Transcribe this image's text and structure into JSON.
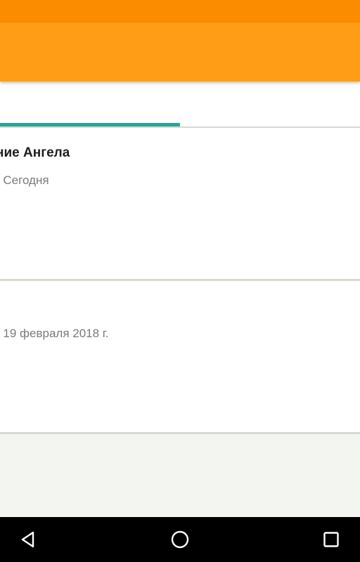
{
  "colors": {
    "status_bar": "#fb8c00",
    "app_bar": "#ff9e16",
    "tab_indicator": "#26a69a",
    "nav_bar": "#000000",
    "background": "#f3f6f0"
  },
  "items": [
    {
      "title": "ние Ангела",
      "subtitle": "- Сегодня"
    },
    {
      "title": "",
      "subtitle": "- 19 февраля 2018 г."
    }
  ],
  "nav": {
    "back_icon": "back-triangle-icon",
    "home_icon": "home-circle-icon",
    "recent_icon": "recent-apps-square-icon"
  }
}
